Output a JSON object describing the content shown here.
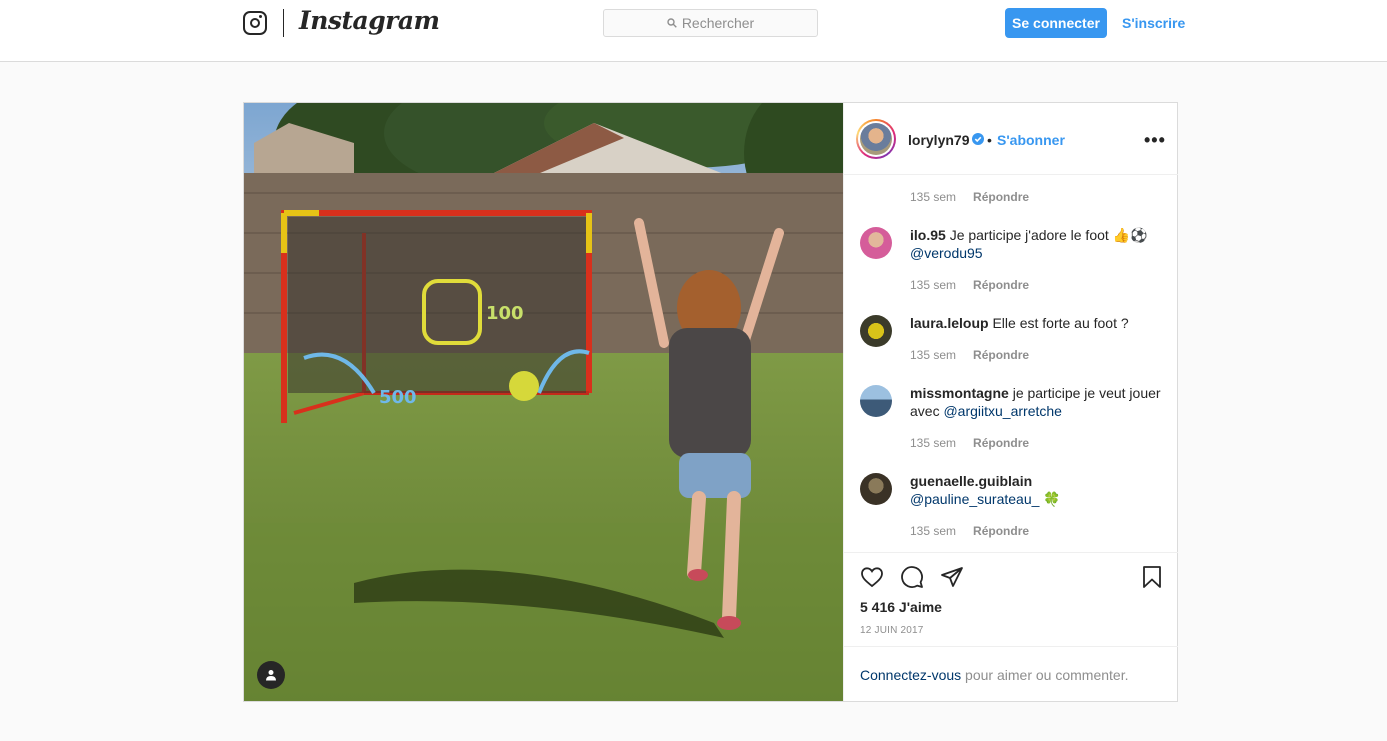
{
  "header": {
    "wordmark": "Instagram",
    "search_placeholder": "Rechercher",
    "login_label": "Se connecter",
    "signup_label": "S'inscrire"
  },
  "post": {
    "owner": "lorylyn79",
    "separator": "•",
    "follow_label": "S'abonner",
    "more_label": "•••",
    "comments": [
      {
        "time": "135 sem",
        "reply": "Répondre"
      },
      {
        "user": "ilo.95",
        "text": "Je participe j'adore le foot 👍⚽",
        "mention": "@verodu95",
        "time": "135 sem",
        "reply": "Répondre"
      },
      {
        "user": "laura.leloup",
        "text": "Elle est forte au foot ?",
        "time": "135 sem",
        "reply": "Répondre"
      },
      {
        "user": "missmontagne",
        "text": "je participe je veut jouer avec",
        "mention": "@argiitxu_arretche",
        "time": "135 sem",
        "reply": "Répondre"
      },
      {
        "user": "guenaelle.guiblain",
        "mention": "@pauline_surateau_",
        "emoji": "🍀",
        "time": "135 sem",
        "reply": "Répondre"
      }
    ],
    "likes": "5 416 J'aime",
    "date": "12 JUIN 2017",
    "login_prompt_link": "Connectez-vous",
    "login_prompt_rest": " pour aimer ou commenter."
  },
  "colors": {
    "accent": "#3897f0",
    "text": "#262626",
    "muted": "#8e8e8e",
    "border": "#dbdbdb",
    "mention": "#00376b"
  },
  "icons": [
    "instagram-glyph-icon",
    "search-icon",
    "verified-badge-icon",
    "more-options-icon",
    "heart-icon",
    "comment-icon",
    "share-icon",
    "bookmark-icon",
    "user-tag-icon"
  ]
}
